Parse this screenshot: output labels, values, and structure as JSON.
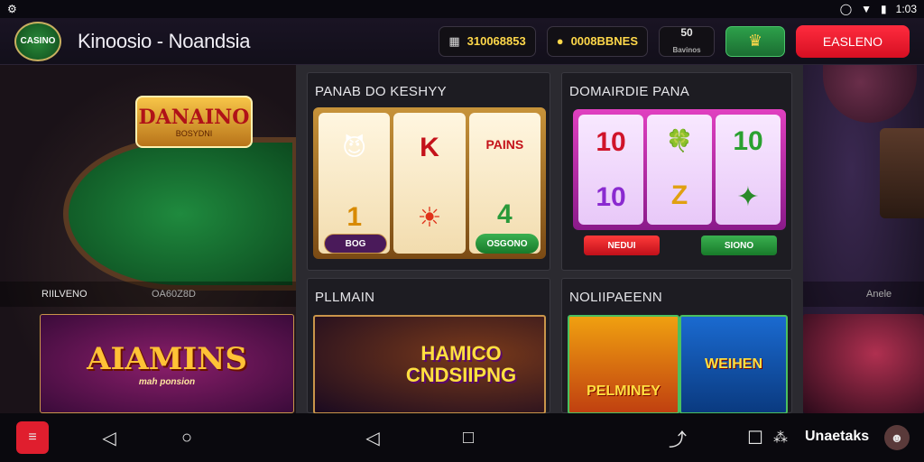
{
  "status": {
    "time": "1:03"
  },
  "header": {
    "app_title": "Kinoosio - Noandsia",
    "logo_text": "CASINO",
    "balance_1": "310068853",
    "balance_2": "0008BBNES",
    "level_top": "50",
    "level_bottom": "Bavinos",
    "signin_label": "EASLENO"
  },
  "left": {
    "sign_text": "DANAINO",
    "sign_sub": "BOSYDNI",
    "label_left": "RIILVENO",
    "label_right": "OA60Z8D",
    "promo_text": "AIAMINS",
    "promo_sub": "mah ponsion"
  },
  "cards": {
    "slots1": {
      "title": "PANAB DO KESHYY",
      "chip_left": "BOG",
      "chip_right": "OSGONO",
      "symbols": [
        "😈",
        "K",
        "PAINS",
        "1",
        "☀",
        "4"
      ]
    },
    "slots2": {
      "title": "DOMAIRDIE PANA",
      "chip_left": "NEDUI",
      "chip_right": "SIONO",
      "symbols": [
        "10",
        "🍀",
        "10",
        "10",
        "Z",
        "✦"
      ]
    },
    "promo1": {
      "title": "PLLMAIN",
      "text": "HAMICO CNDSIIPNG"
    },
    "promo2": {
      "title": "NOLIIPAEENN",
      "text_left": "PELMINEY",
      "text_right": "WEIHEN"
    }
  },
  "right": {
    "label": "Anele"
  },
  "navbar": {
    "brand": "Unaetaks"
  }
}
